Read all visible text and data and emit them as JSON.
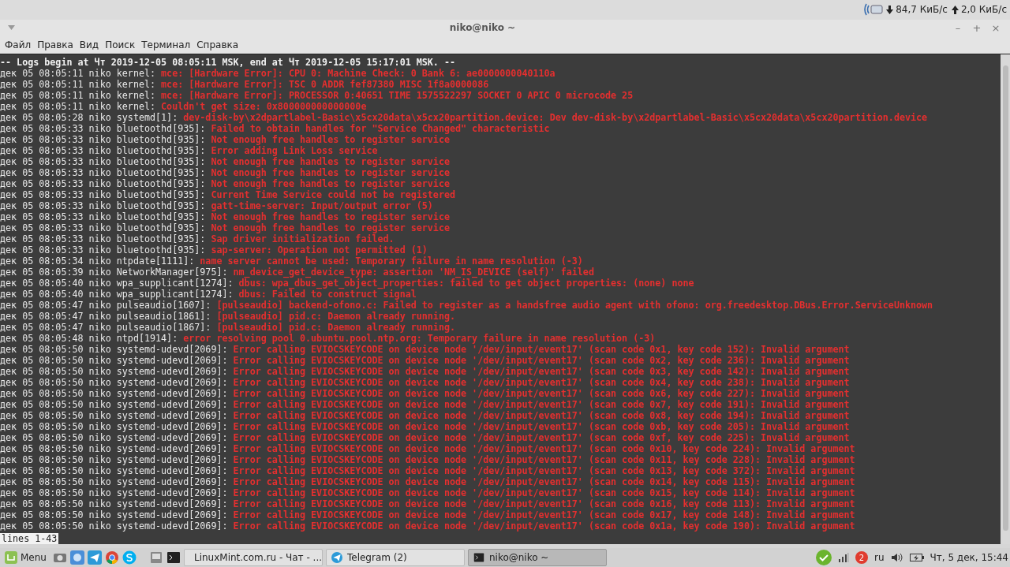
{
  "top_panel": {
    "download": "84,7 КиБ/с",
    "upload": "2,0 КиБ/с"
  },
  "window": {
    "title": "niko@niko ~",
    "controls": [
      "–",
      "+",
      "×"
    ]
  },
  "menu": [
    "Файл",
    "Правка",
    "Вид",
    "Поиск",
    "Терминал",
    "Справка"
  ],
  "terminal": {
    "header": "-- Logs begin at Чт 2019-12-05 08:05:11 MSK, end at Чт 2019-12-05 15:17:01 MSK. --",
    "lines": [
      {
        "prefix": "дек 05 08:05:11 niko kernel: ",
        "message": "mce: [Hardware Error]: CPU 0: Machine Check: 0 Bank 6: ae0000000040110a"
      },
      {
        "prefix": "дек 05 08:05:11 niko kernel: ",
        "message": "mce: [Hardware Error]: TSC 0 ADDR fef87380 MISC 1f8a0000086"
      },
      {
        "prefix": "дек 05 08:05:11 niko kernel: ",
        "message": "mce: [Hardware Error]: PROCESSOR 0:40651 TIME 1575522297 SOCKET 0 APIC 0 microcode 25"
      },
      {
        "prefix": "дек 05 08:05:11 niko kernel: ",
        "message": "Couldn't get size: 0x800000000000000e"
      },
      {
        "prefix": "дек 05 08:05:28 niko systemd[1]: ",
        "message": "dev-disk-by\\x2dpartlabel-Basic\\x5cx20data\\x5cx20partition.device: Dev dev-disk-by\\x2dpartlabel-Basic\\x5cx20data\\x5cx20partition.device"
      },
      {
        "prefix": "дек 05 08:05:33 niko bluetoothd[935]: ",
        "message": "Failed to obtain handles for \"Service Changed\" characteristic"
      },
      {
        "prefix": "дек 05 08:05:33 niko bluetoothd[935]: ",
        "message": "Not enough free handles to register service"
      },
      {
        "prefix": "дек 05 08:05:33 niko bluetoothd[935]: ",
        "message": "Error adding Link Loss service"
      },
      {
        "prefix": "дек 05 08:05:33 niko bluetoothd[935]: ",
        "message": "Not enough free handles to register service"
      },
      {
        "prefix": "дек 05 08:05:33 niko bluetoothd[935]: ",
        "message": "Not enough free handles to register service"
      },
      {
        "prefix": "дек 05 08:05:33 niko bluetoothd[935]: ",
        "message": "Not enough free handles to register service"
      },
      {
        "prefix": "дек 05 08:05:33 niko bluetoothd[935]: ",
        "message": "Current Time Service could not be registered"
      },
      {
        "prefix": "дек 05 08:05:33 niko bluetoothd[935]: ",
        "message": "gatt-time-server: Input/output error (5)"
      },
      {
        "prefix": "дек 05 08:05:33 niko bluetoothd[935]: ",
        "message": "Not enough free handles to register service"
      },
      {
        "prefix": "дек 05 08:05:33 niko bluetoothd[935]: ",
        "message": "Not enough free handles to register service"
      },
      {
        "prefix": "дек 05 08:05:33 niko bluetoothd[935]: ",
        "message": "Sap driver initialization failed."
      },
      {
        "prefix": "дек 05 08:05:33 niko bluetoothd[935]: ",
        "message": "sap-server: Operation not permitted (1)"
      },
      {
        "prefix": "дек 05 08:05:34 niko ntpdate[1111]: ",
        "message": "name server cannot be used: Temporary failure in name resolution (-3)"
      },
      {
        "prefix": "дек 05 08:05:39 niko NetworkManager[975]: ",
        "message": "nm_device_get_device_type: assertion 'NM_IS_DEVICE (self)' failed"
      },
      {
        "prefix": "дек 05 08:05:40 niko wpa_supplicant[1274]: ",
        "message": "dbus: wpa_dbus_get_object_properties: failed to get object properties: (none) none"
      },
      {
        "prefix": "дек 05 08:05:40 niko wpa_supplicant[1274]: ",
        "message": "dbus: Failed to construct signal"
      },
      {
        "prefix": "дек 05 08:05:47 niko pulseaudio[1607]: ",
        "message": "[pulseaudio] backend-ofono.c: Failed to register as a handsfree audio agent with ofono: org.freedesktop.DBus.Error.ServiceUnknown"
      },
      {
        "prefix": "дек 05 08:05:47 niko pulseaudio[1861]: ",
        "message": "[pulseaudio] pid.c: Daemon already running."
      },
      {
        "prefix": "дек 05 08:05:47 niko pulseaudio[1867]: ",
        "message": "[pulseaudio] pid.c: Daemon already running."
      },
      {
        "prefix": "дек 05 08:05:48 niko ntpd[1914]: ",
        "message": "error resolving pool 0.ubuntu.pool.ntp.org: Temporary failure in name resolution (-3)"
      },
      {
        "prefix": "дек 05 08:05:50 niko systemd-udevd[2069]: ",
        "message": "Error calling EVIOCSKEYCODE on device node '/dev/input/event17' (scan code 0x1, key code 152): Invalid argument"
      },
      {
        "prefix": "дек 05 08:05:50 niko systemd-udevd[2069]: ",
        "message": "Error calling EVIOCSKEYCODE on device node '/dev/input/event17' (scan code 0x2, key code 236): Invalid argument"
      },
      {
        "prefix": "дек 05 08:05:50 niko systemd-udevd[2069]: ",
        "message": "Error calling EVIOCSKEYCODE on device node '/dev/input/event17' (scan code 0x3, key code 142): Invalid argument"
      },
      {
        "prefix": "дек 05 08:05:50 niko systemd-udevd[2069]: ",
        "message": "Error calling EVIOCSKEYCODE on device node '/dev/input/event17' (scan code 0x4, key code 238): Invalid argument"
      },
      {
        "prefix": "дек 05 08:05:50 niko systemd-udevd[2069]: ",
        "message": "Error calling EVIOCSKEYCODE on device node '/dev/input/event17' (scan code 0x6, key code 227): Invalid argument"
      },
      {
        "prefix": "дек 05 08:05:50 niko systemd-udevd[2069]: ",
        "message": "Error calling EVIOCSKEYCODE on device node '/dev/input/event17' (scan code 0x7, key code 191): Invalid argument"
      },
      {
        "prefix": "дек 05 08:05:50 niko systemd-udevd[2069]: ",
        "message": "Error calling EVIOCSKEYCODE on device node '/dev/input/event17' (scan code 0x8, key code 194): Invalid argument"
      },
      {
        "prefix": "дек 05 08:05:50 niko systemd-udevd[2069]: ",
        "message": "Error calling EVIOCSKEYCODE on device node '/dev/input/event17' (scan code 0xb, key code 205): Invalid argument"
      },
      {
        "prefix": "дек 05 08:05:50 niko systemd-udevd[2069]: ",
        "message": "Error calling EVIOCSKEYCODE on device node '/dev/input/event17' (scan code 0xf, key code 225): Invalid argument"
      },
      {
        "prefix": "дек 05 08:05:50 niko systemd-udevd[2069]: ",
        "message": "Error calling EVIOCSKEYCODE on device node '/dev/input/event17' (scan code 0x10, key code 224): Invalid argument"
      },
      {
        "prefix": "дек 05 08:05:50 niko systemd-udevd[2069]: ",
        "message": "Error calling EVIOCSKEYCODE on device node '/dev/input/event17' (scan code 0x11, key code 228): Invalid argument"
      },
      {
        "prefix": "дек 05 08:05:50 niko systemd-udevd[2069]: ",
        "message": "Error calling EVIOCSKEYCODE on device node '/dev/input/event17' (scan code 0x13, key code 372): Invalid argument"
      },
      {
        "prefix": "дек 05 08:05:50 niko systemd-udevd[2069]: ",
        "message": "Error calling EVIOCSKEYCODE on device node '/dev/input/event17' (scan code 0x14, key code 115): Invalid argument"
      },
      {
        "prefix": "дек 05 08:05:50 niko systemd-udevd[2069]: ",
        "message": "Error calling EVIOCSKEYCODE on device node '/dev/input/event17' (scan code 0x15, key code 114): Invalid argument"
      },
      {
        "prefix": "дек 05 08:05:50 niko systemd-udevd[2069]: ",
        "message": "Error calling EVIOCSKEYCODE on device node '/dev/input/event17' (scan code 0x16, key code 113): Invalid argument"
      },
      {
        "prefix": "дек 05 08:05:50 niko systemd-udevd[2069]: ",
        "message": "Error calling EVIOCSKEYCODE on device node '/dev/input/event17' (scan code 0x17, key code 148): Invalid argument"
      },
      {
        "prefix": "дек 05 08:05:50 niko systemd-udevd[2069]: ",
        "message": "Error calling EVIOCSKEYCODE on device node '/dev/input/event17' (scan code 0x1a, key code 190): Invalid argument"
      }
    ],
    "pager_status": "lines 1-43"
  },
  "taskbar": {
    "menu_label": "Menu",
    "windows": [
      {
        "label": "LinuxMint.com.ru - Чат - ...",
        "kind": "browser",
        "selected": false
      },
      {
        "label": "Telegram (2)",
        "kind": "telegram",
        "selected": false
      },
      {
        "label": "niko@niko ~",
        "kind": "terminal",
        "selected": true
      }
    ],
    "notification_count": "2",
    "keyboard_layout": "ru",
    "clock": "Чт, 5 дек, 15:44"
  }
}
